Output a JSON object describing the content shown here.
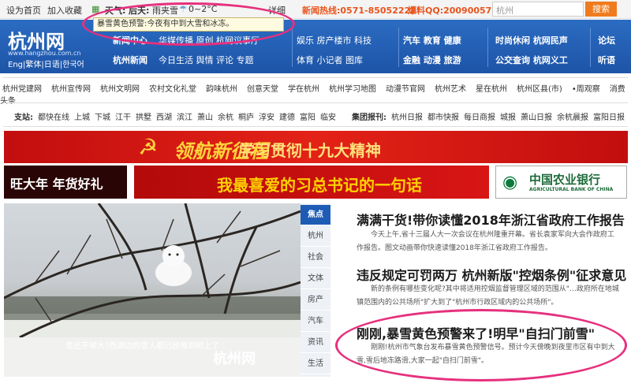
{
  "topbar": {
    "set_home": "设为首页",
    "bookmark": "加入收藏",
    "weather_label": "天气:",
    "tomorrow": "后天:",
    "weather": "雨夹雪",
    "temp": "0~2°C",
    "detail": "详细",
    "hotline": "新闻热线:0571-85052222",
    "qq": "爆料QQ:200900571",
    "search_value": "杭州",
    "search_btn": "搜索",
    "weather_tip": "暴雪黄色预警:今夜有中到大雪和冰冻。"
  },
  "nav": {
    "logo": "杭州网",
    "logo_url": "www.hangzhou.com.cn",
    "lang": "Eng|繁体|日语|한국어",
    "col1": [
      "新闻中心",
      "杭州新闻"
    ],
    "col2": [
      "华媒传播  原创  杭网议事厅",
      "今日生活  舆情  评论  专题"
    ],
    "col3": [
      "娱乐  房产楼市  科技",
      "体育  小记者  图库"
    ],
    "col4": [
      "汽车  教育  健康",
      "金融  动漫  旅游"
    ],
    "col5": [
      "时尚休闲  杭网民声",
      "公交查询  杭网义工"
    ],
    "col6": [
      "论坛",
      "听语"
    ]
  },
  "links_row1": [
    "杭州党建网",
    "杭州宣传网",
    "杭州文明网",
    "农村文化礼堂",
    "韵味杭州",
    "创意天堂",
    "学在杭州",
    "杭州学习地图",
    "动漫节官网",
    "杭州艺术",
    "星在杭州",
    "杭州区县(市)",
    "•周观察",
    "消费头条"
  ],
  "links_row2": {
    "label1": "支站:",
    "items1": [
      "都快在线",
      "上城",
      "下城",
      "江干",
      "拱墅",
      "西湖",
      "滨江",
      "萧山",
      "余杭",
      "桐庐",
      "淳安",
      "建德",
      "富阳",
      "临安"
    ],
    "label2": "集团报刊:",
    "items2": [
      "杭州日报",
      "都市快报",
      "每日商报",
      "城报",
      "萧山日报",
      "余杭晨报",
      "富阳日报"
    ]
  },
  "banners": {
    "red_title": "领航新征程",
    "red_sub": "学习贯彻十九大精神",
    "ad1": "旺大年 年货好礼",
    "ad2": "我最喜爱的习总书记的一句话",
    "ad3_cn": "中国农业银行",
    "ad3_en": "AGRICULTURAL BANK OF CHINA"
  },
  "photo": {
    "caption": "雪还不够大?西湖边的雪人都已经堆到树上了",
    "watermark": "杭州网",
    "watermark_url": "www.hangzhou.com.cn"
  },
  "sidetabs": [
    "焦点",
    "杭州",
    "社会",
    "文体",
    "房产",
    "汽车",
    "资讯",
    "生活"
  ],
  "news": [
    {
      "title": "满满干货!带你读懂2018年浙江省政府工作报告",
      "summary": "今天上午,省十三届人大一次会议在杭州隆重开幕。省长袁家军向大会作政府工作报告。图文动画带你快速读懂2018年浙江省政府工作报告。"
    },
    {
      "title": "违反规定可罚两万 杭州新版\"控烟条例\"征求意见",
      "summary": "新的条例有哪些变化呢?其中将适用控烟监督管理区域的范围从\"…政府所在地城镇范围内的公共场所\"扩大到了\"杭州市行政区域内的公共场所\"。"
    },
    {
      "title": "刚刚,暴雪黄色预警来了!明早\"自扫门前雪\"",
      "summary": "刚刚!杭州市气象台发布暴雪黄色预警信号。预计今天傍晚到夜里市区有中到大雪,雪后地冻路滑,大家一起\"自扫门前雪\"。"
    }
  ]
}
